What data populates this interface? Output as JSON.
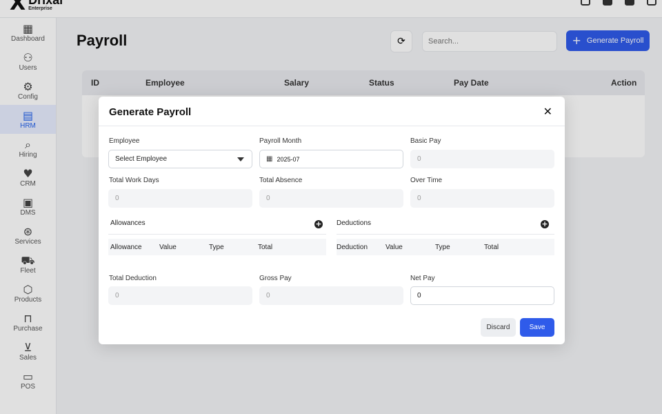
{
  "brand": {
    "mark": "X",
    "name": "Drixal",
    "sub": "Enterprise"
  },
  "sidebar": {
    "items": [
      {
        "label": "Dashboard",
        "icon": "▦"
      },
      {
        "label": "Users",
        "icon": "⚇"
      },
      {
        "label": "Config",
        "icon": "⚙"
      },
      {
        "label": "HRM",
        "icon": "▤"
      },
      {
        "label": "Hiring",
        "icon": "⌕"
      },
      {
        "label": "CRM",
        "icon": "♥"
      },
      {
        "label": "DMS",
        "icon": "▣"
      },
      {
        "label": "Services",
        "icon": "⊛"
      },
      {
        "label": "Fleet",
        "icon": "⛟"
      },
      {
        "label": "Products",
        "icon": "⬡"
      },
      {
        "label": "Purchase",
        "icon": "⊓"
      },
      {
        "label": "Sales",
        "icon": "⊻"
      },
      {
        "label": "POS",
        "icon": "▭"
      }
    ]
  },
  "page": {
    "title": "Payroll",
    "search_placeholder": "Search...",
    "generate_button": "Generate Payroll",
    "refresh_icon": "⟳",
    "table_headers": {
      "id": "ID",
      "employee": "Employee",
      "salary": "Salary",
      "status": "Status",
      "pay_date": "Pay Date",
      "action": "Action"
    }
  },
  "modal": {
    "title": "Generate Payroll",
    "close_icon": "✕",
    "employee": {
      "label": "Employee",
      "value": "Select Employee"
    },
    "payroll_month": {
      "label": "Payroll Month",
      "value": "2025-07",
      "icon": "▦"
    },
    "basic_pay": {
      "label": "Basic Pay",
      "placeholder": "0"
    },
    "total_work_days": {
      "label": "Total Work Days",
      "placeholder": "0"
    },
    "total_absence": {
      "label": "Total Absence",
      "placeholder": "0"
    },
    "over_time": {
      "label": "Over Time",
      "placeholder": "0"
    },
    "allowances": {
      "title": "Allowances",
      "columns": [
        "Allowance",
        "Value",
        "Type",
        "Total"
      ]
    },
    "deductions": {
      "title": "Deductions",
      "columns": [
        "Deduction",
        "Value",
        "Type",
        "Total"
      ]
    },
    "total_deduction": {
      "label": "Total Deduction",
      "placeholder": "0"
    },
    "gross_pay": {
      "label": "Gross Pay",
      "placeholder": "0"
    },
    "net_pay": {
      "label": "Net Pay",
      "value": "0"
    },
    "discard": "Discard",
    "save": "Save"
  }
}
